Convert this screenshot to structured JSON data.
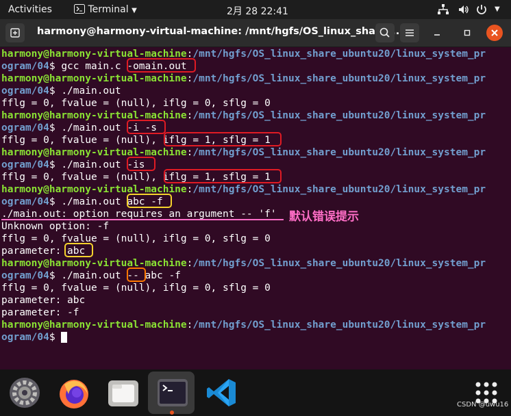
{
  "topbar": {
    "activities": "Activities",
    "app_name": "Terminal",
    "clock": "2月 28  22:41"
  },
  "window": {
    "title": "harmony@harmony-virtual-machine: /mnt/hgfs/OS_linux_share_..."
  },
  "terminal": {
    "lines": [
      {
        "kind": "prompt1",
        "user": "harmony@harmony-virtual-machine",
        "path": "/mnt/hgfs/OS_linux_share_ubuntu20/linux_system_pr"
      },
      {
        "kind": "prompt2",
        "path": "ogram/04",
        "cmd": "gcc main.c -omain.out"
      },
      {
        "kind": "prompt1",
        "user": "harmony@harmony-virtual-machine",
        "path": "/mnt/hgfs/OS_linux_share_ubuntu20/linux_system_pr"
      },
      {
        "kind": "prompt2",
        "path": "ogram/04",
        "cmd": "./main.out"
      },
      {
        "kind": "out",
        "text": "fflg = 0, fvalue = (null), iflg = 0, sflg = 0"
      },
      {
        "kind": "prompt1",
        "user": "harmony@harmony-virtual-machine",
        "path": "/mnt/hgfs/OS_linux_share_ubuntu20/linux_system_pr"
      },
      {
        "kind": "prompt2",
        "path": "ogram/04",
        "cmd": "./main.out -i -s"
      },
      {
        "kind": "out",
        "text": "fflg = 0, fvalue = (null), iflg = 1, sflg = 1"
      },
      {
        "kind": "prompt1",
        "user": "harmony@harmony-virtual-machine",
        "path": "/mnt/hgfs/OS_linux_share_ubuntu20/linux_system_pr"
      },
      {
        "kind": "prompt2",
        "path": "ogram/04",
        "cmd": "./main.out -is"
      },
      {
        "kind": "out",
        "text": "fflg = 0, fvalue = (null), iflg = 1, sflg = 1"
      },
      {
        "kind": "prompt1",
        "user": "harmony@harmony-virtual-machine",
        "path": "/mnt/hgfs/OS_linux_share_ubuntu20/linux_system_pr"
      },
      {
        "kind": "prompt2",
        "path": "ogram/04",
        "cmd": "./main.out abc -f"
      },
      {
        "kind": "out",
        "text": "./main.out: option requires an argument -- 'f'"
      },
      {
        "kind": "out",
        "text": "Unknown option: -f"
      },
      {
        "kind": "out",
        "text": "fflg = 0, fvalue = (null), iflg = 0, sflg = 0"
      },
      {
        "kind": "out",
        "text": "parameter: abc"
      },
      {
        "kind": "prompt1",
        "user": "harmony@harmony-virtual-machine",
        "path": "/mnt/hgfs/OS_linux_share_ubuntu20/linux_system_pr"
      },
      {
        "kind": "prompt2",
        "path": "ogram/04",
        "cmd": "./main.out -- abc -f"
      },
      {
        "kind": "out",
        "text": "fflg = 0, fvalue = (null), iflg = 0, sflg = 0"
      },
      {
        "kind": "out",
        "text": "parameter: abc"
      },
      {
        "kind": "out",
        "text": "parameter: -f"
      },
      {
        "kind": "prompt1",
        "user": "harmony@harmony-virtual-machine",
        "path": "/mnt/hgfs/OS_linux_share_ubuntu20/linux_system_pr"
      },
      {
        "kind": "prompt2",
        "path": "ogram/04",
        "cmd": ""
      }
    ],
    "annotation": "默认错误提示"
  },
  "dock": {
    "apps": [
      {
        "icon": "settings-icon",
        "active": false
      },
      {
        "icon": "firefox-icon",
        "active": false
      },
      {
        "icon": "files-icon",
        "active": false
      },
      {
        "icon": "terminal-icon",
        "active": true
      },
      {
        "icon": "vscode-icon",
        "active": false
      },
      {
        "icon": "app-grid-icon",
        "active": false
      }
    ]
  },
  "watermark": "CSDN @uwu16",
  "colors": {
    "terminal_bg": "#300a24",
    "prompt_user": "#8ae234",
    "prompt_path": "#729fcf",
    "box_red": "#e01b24",
    "box_yellow": "#f6d32d",
    "box_orange": "#ff7800",
    "annotation": "#ff6ec7"
  }
}
